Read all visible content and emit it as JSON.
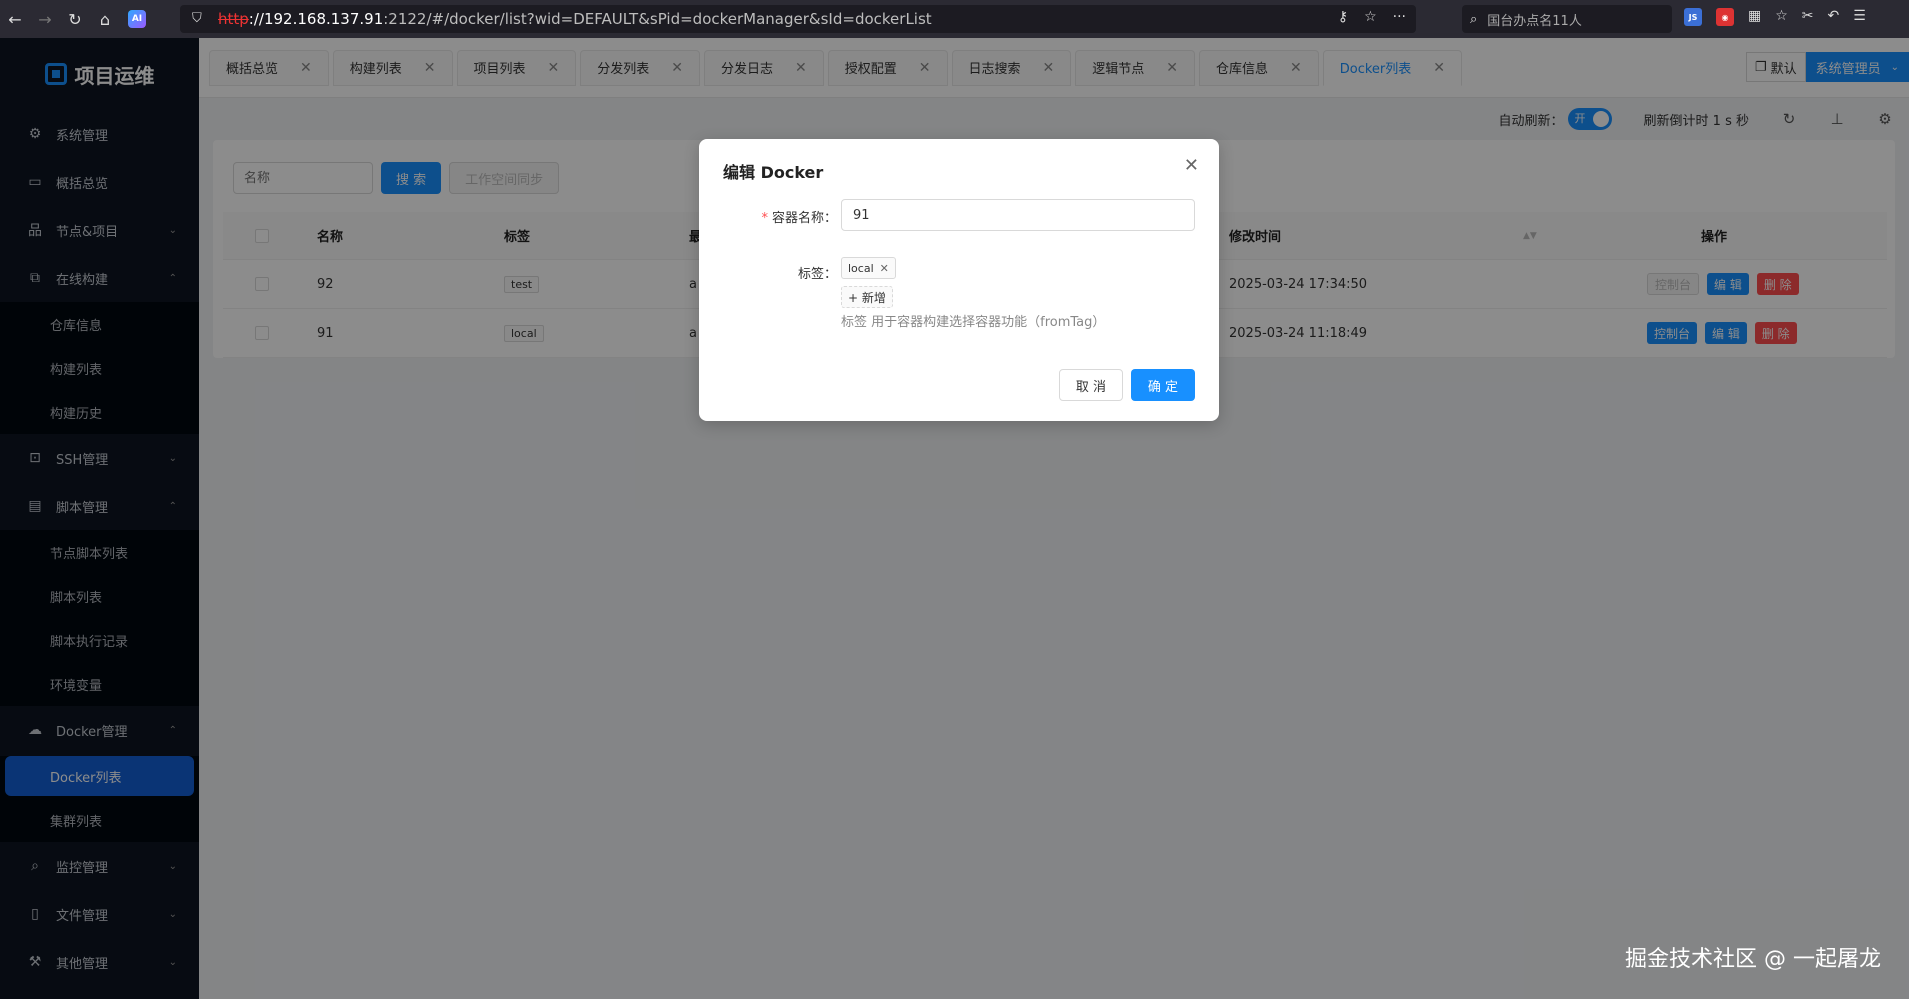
{
  "browser": {
    "url_protocol": "http",
    "url_host": "://192.168.137.91",
    "url_rest": ":2122/#/docker/list?wid=DEFAULT&sPid=dockerManager&sId=dockerList",
    "search_placeholder": "国台办点名11人"
  },
  "sidebar": {
    "logo": "项目运维",
    "items": [
      {
        "label": "系统管理"
      },
      {
        "label": "概括总览"
      },
      {
        "label": "节点&项目"
      },
      {
        "label": "在线构建"
      }
    ],
    "build_sub": [
      "仓库信息",
      "构建列表",
      "构建历史"
    ],
    "ssh": "SSH管理",
    "script": "脚本管理",
    "script_sub": [
      "节点脚本列表",
      "脚本列表",
      "脚本执行记录",
      "环境变量"
    ],
    "docker": "Docker管理",
    "docker_sub": [
      "Docker列表",
      "集群列表"
    ],
    "monitor": "监控管理",
    "file": "文件管理",
    "other": "其他管理"
  },
  "tabs": [
    "概括总览",
    "构建列表",
    "项目列表",
    "分发列表",
    "分发日志",
    "授权配置",
    "日志搜索",
    "逻辑节点",
    "仓库信息",
    "Docker列表"
  ],
  "header": {
    "workspace": "默认",
    "user": "系统管理员"
  },
  "toolbar": {
    "auto_refresh_label": "自动刷新：",
    "switch_on": "开",
    "countdown": "刷新倒计时 1 s 秒"
  },
  "search": {
    "name_placeholder": "名称",
    "search_btn": "搜 索",
    "sync_btn": "工作空间同步"
  },
  "table": {
    "headers": {
      "name": "名称",
      "tag": "标签",
      "col3": "最",
      "modified": "修改时间",
      "ops": "操作"
    },
    "rows": [
      {
        "name": "92",
        "tag": "test",
        "col3": "a",
        "modified": "2025-03-24 17:34:50"
      },
      {
        "name": "91",
        "tag": "local",
        "col3": "a",
        "modified": "2025-03-24 11:18:49"
      }
    ],
    "op_console": "控制台",
    "op_edit": "编 辑",
    "op_delete": "删 除"
  },
  "modal": {
    "title": "编辑 Docker",
    "name_label": "容器名称：",
    "name_value": "91",
    "tag_label": "标签：",
    "tag_value": "local",
    "add_tag": "+ 新增",
    "help": "标签 用于容器构建选择容器功能（fromTag）",
    "cancel": "取 消",
    "ok": "确 定"
  },
  "watermark": "掘金技术社区 @ 一起屠龙",
  "colors": {
    "accent": "#1890ff",
    "danger": "#ff4d4f",
    "sidebar_bg": "#0d1521"
  }
}
